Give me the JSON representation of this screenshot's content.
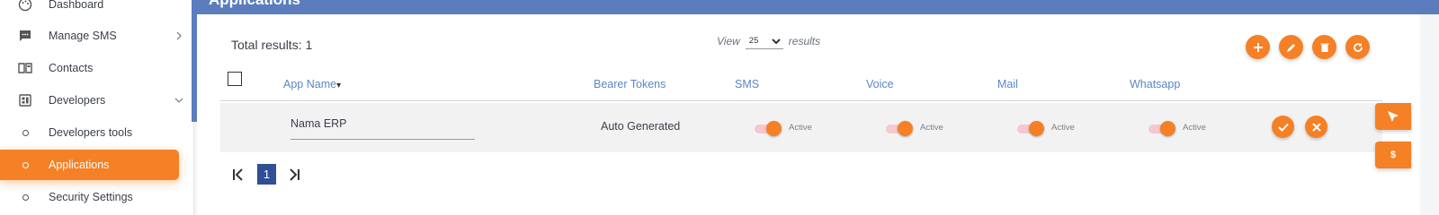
{
  "sidebar": {
    "items": [
      {
        "label": "Dashboard",
        "icon": "palette-icon"
      },
      {
        "label": "Manage SMS",
        "icon": "chat-icon"
      },
      {
        "label": "Contacts",
        "icon": "book-icon"
      },
      {
        "label": "Developers",
        "icon": "developer-board-icon"
      },
      {
        "label": "Developers tools",
        "icon": "circle-outline-icon"
      },
      {
        "label": "Applications",
        "icon": "circle-outline-icon"
      },
      {
        "label": "Security Settings",
        "icon": "circle-outline-icon"
      }
    ],
    "active": "Applications"
  },
  "page": {
    "title": "Applications"
  },
  "results": {
    "total_label": "Total results: 1",
    "view_prefix": "View",
    "view_value": "25",
    "view_options": [
      "25"
    ],
    "view_suffix": "results"
  },
  "table": {
    "columns": [
      "App Name",
      "Bearer Tokens",
      "SMS",
      "Voice",
      "Mail",
      "Whatsapp"
    ],
    "sort_indicator": "▾",
    "rows": [
      {
        "app_name": "Nama ERP",
        "bearer": "Auto Generated",
        "sms": "Active",
        "voice": "Active",
        "mail": "Active",
        "whatsapp": "Active"
      }
    ]
  },
  "pagination": {
    "current": "1"
  },
  "floating": {
    "currency_label": "$"
  },
  "colors": {
    "accent": "#f58025",
    "header_blue": "#5b7dbd",
    "link_blue": "#5b86c7",
    "page_active": "#2f4f96"
  }
}
